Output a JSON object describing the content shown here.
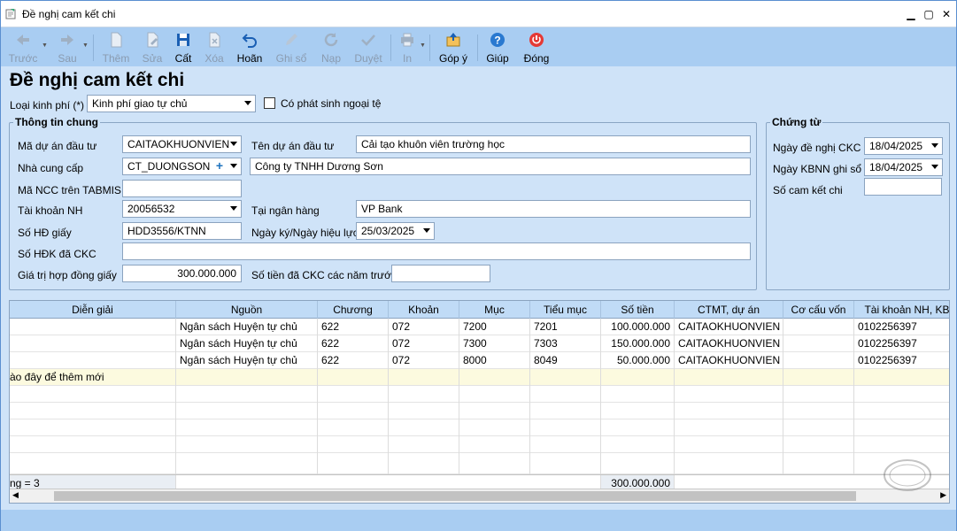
{
  "window": {
    "title": "Đề nghị cam kết chi",
    "min": "▁",
    "max": "▢",
    "close": "✕"
  },
  "toolbar": [
    {
      "label": "Trước",
      "icon": "arrow-left-icon",
      "enabled": false
    },
    {
      "label": "Sau",
      "icon": "arrow-right-icon",
      "enabled": false
    },
    {
      "label": "Thêm",
      "icon": "new-document-icon",
      "enabled": false
    },
    {
      "label": "Sửa",
      "icon": "edit-document-icon",
      "enabled": false
    },
    {
      "label": "Cất",
      "icon": "save-icon",
      "enabled": true
    },
    {
      "label": "Xóa",
      "icon": "delete-document-icon",
      "enabled": false
    },
    {
      "label": "Hoãn",
      "icon": "undo-icon",
      "enabled": true
    },
    {
      "label": "Ghi sổ",
      "icon": "pencil-icon",
      "enabled": false
    },
    {
      "label": "Nạp",
      "icon": "refresh-icon",
      "enabled": false
    },
    {
      "label": "Duyệt",
      "icon": "checkmark-icon",
      "enabled": false
    },
    {
      "label": "In",
      "icon": "printer-icon",
      "enabled": false
    },
    {
      "label": "Góp ý",
      "icon": "feedback-upload-icon",
      "enabled": true
    },
    {
      "label": "Giúp",
      "icon": "help-icon",
      "enabled": true
    },
    {
      "label": "Đóng",
      "icon": "power-icon",
      "enabled": true
    }
  ],
  "page_title": "Đề nghị cam kết chi",
  "loai_kinh_phi": {
    "label": "Loại kinh phí (*)",
    "value": "Kinh phí giao tự chủ"
  },
  "ngoai_te": {
    "label": "Có phát sinh ngoại tệ",
    "checked": false
  },
  "thong_tin_chung": {
    "legend": "Thông tin chung",
    "ma_du_an": {
      "label": "Mã dự án đầu tư",
      "value": "CAITAOKHUONVIEN"
    },
    "ten_du_an": {
      "label": "Tên dự án đầu tư",
      "value": "Cải tạo khuôn viên trường học"
    },
    "nha_cung_cap": {
      "label": "Nhà cung cấp",
      "value": "CT_DUONGSON",
      "name": "Công ty TNHH Dương Sơn"
    },
    "ma_ncc": {
      "label": "Mã NCC trên TABMIS",
      "value": ""
    },
    "tai_khoan": {
      "label": "Tài khoản NH",
      "value": "20056532"
    },
    "ngan_hang": {
      "label": "Tại ngân hàng",
      "value": "VP Bank"
    },
    "so_hd": {
      "label": "Số HĐ giấy",
      "value": "HDD3556/KTNN"
    },
    "ngay_ky": {
      "label": "Ngày ký/Ngày hiệu lực",
      "value": "25/03/2025"
    },
    "so_hdk": {
      "label": "Số HĐK đã CKC",
      "value": ""
    },
    "gia_tri": {
      "label": "Giá trị hợp đồng giấy",
      "value": "300.000.000"
    },
    "so_tien_truoc": {
      "label": "Số tiền đã CKC các năm trước",
      "value": ""
    }
  },
  "chung_tu": {
    "legend": "Chứng từ",
    "ngay_de_nghi": {
      "label": "Ngày đề nghị CKC",
      "value": "18/04/2025"
    },
    "ngay_kbnn": {
      "label": "Ngày KBNN ghi sổ",
      "value": "18/04/2025"
    },
    "so_cam_ket": {
      "label": "Số cam kết chi",
      "value": ""
    }
  },
  "grid": {
    "columns": [
      "Diễn giải",
      "Nguồn",
      "Chương",
      "Khoản",
      "Mục",
      "Tiểu mục",
      "Số tiền",
      "CTMT, dự án",
      "Cơ cấu vốn",
      "Tài khoản NH, KB"
    ],
    "rows": [
      [
        "",
        "Ngân sách Huyện tự chủ",
        "622",
        "072",
        "7200",
        "7201",
        "100.000.000",
        "CAITAOKHUONVIEN",
        "",
        "0102256397"
      ],
      [
        "",
        "Ngân sách Huyện tự chủ",
        "622",
        "072",
        "7300",
        "7303",
        "150.000.000",
        "CAITAOKHUONVIEN",
        "",
        "0102256397"
      ],
      [
        "",
        "Ngân sách Huyện tự chủ",
        "622",
        "072",
        "8000",
        "8049",
        "50.000.000",
        "CAITAOKHUONVIEN",
        "",
        "0102256397"
      ]
    ],
    "new_row_hint": "ào đây để thêm mới",
    "footer_count": "ng = 3",
    "footer_total": "300.000.000"
  },
  "colors": {
    "toolbar": "#a9cdf2",
    "panel": "#cfe3f8",
    "grid_header": "#c0dbf6",
    "new_row": "#fcfadf"
  }
}
